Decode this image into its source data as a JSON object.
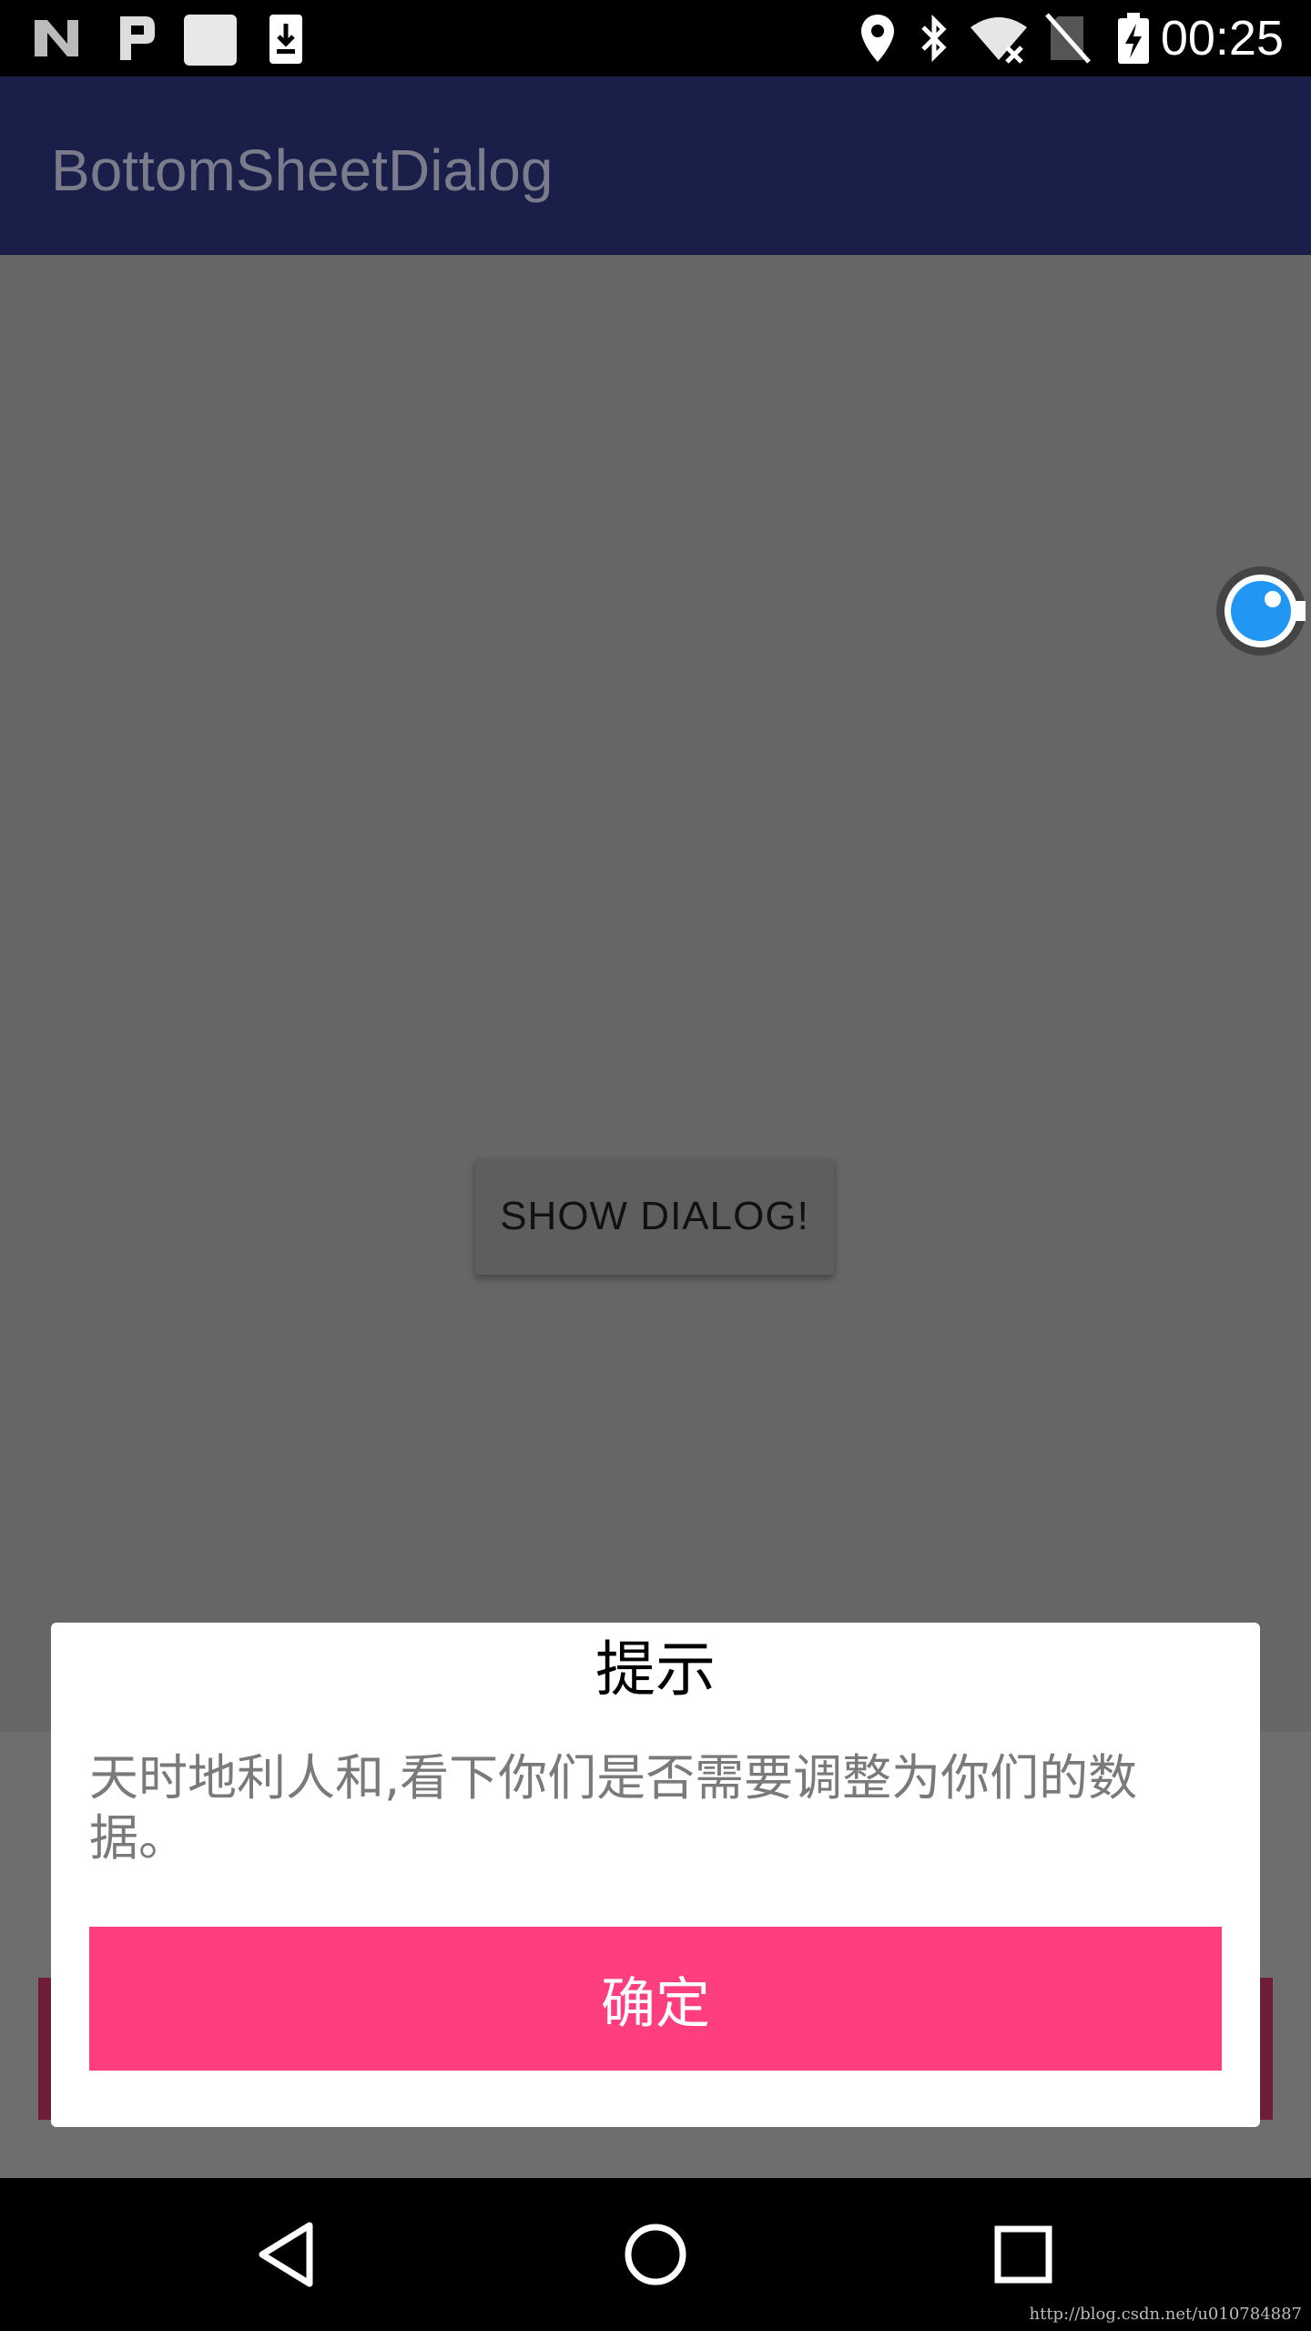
{
  "status_bar": {
    "time": "00:25",
    "icons": [
      "n-preview-icon",
      "p-icon",
      "blank-square-icon",
      "download-icon",
      "location-icon",
      "bluetooth-icon",
      "wifi-icon",
      "no-sim-icon",
      "battery-charging-icon"
    ]
  },
  "app_bar": {
    "title": "BottomSheetDialog",
    "background": "#1a1f4a"
  },
  "main": {
    "show_button_label": "SHOW DIALOG!",
    "floating_icon": "assistive-touch-icon"
  },
  "dialog": {
    "title": "提示",
    "message": "天时地利人和,看下你们是否需要调整为你们的数据。",
    "confirm_label": "确定",
    "confirm_color": "#ff3e7f"
  },
  "nav_bar": {
    "icons": [
      "back-icon",
      "home-icon",
      "recents-icon"
    ]
  },
  "watermark": "http://blog.csdn.net/u010784887"
}
